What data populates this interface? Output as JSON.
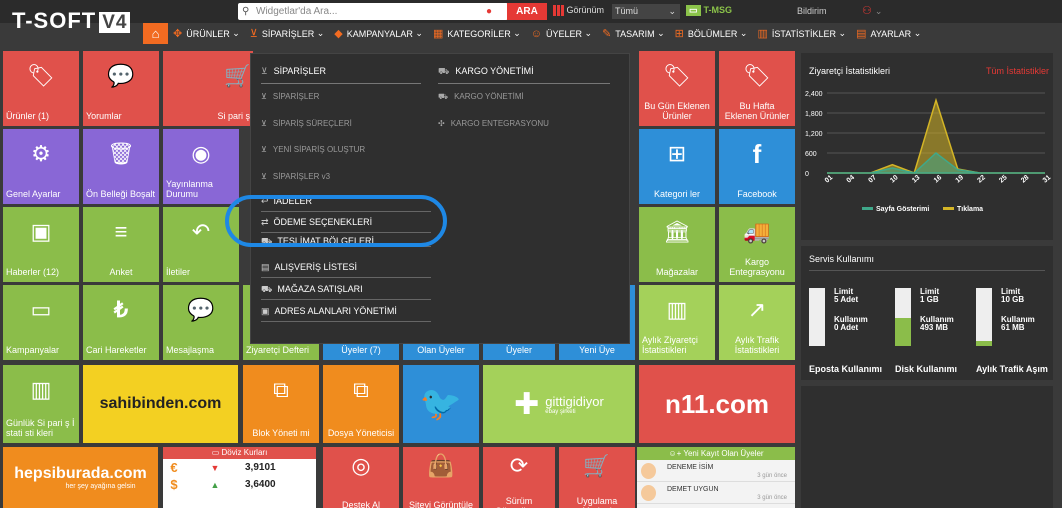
{
  "topbar": {
    "logo_text": "T-SOFT",
    "logo_version": "V4",
    "search_placeholder": "Widgetlar'da Ara...",
    "search_button": "ARA",
    "view_label": "Görünüm",
    "view_selected": "Tümü",
    "tmsg_label": "T-MSG",
    "notifications_label": "Bildirim"
  },
  "nav": {
    "items": [
      {
        "icon": "puzzle-icon",
        "glyph": "✥",
        "label": "ÜRÜNLER"
      },
      {
        "icon": "cart-icon",
        "glyph": "🛒",
        "label": "SİPARİŞLER"
      },
      {
        "icon": "tag-icon",
        "glyph": "◆",
        "label": "KAMPANYALAR"
      },
      {
        "icon": "categories-icon",
        "glyph": "▦",
        "label": "KATEGORİLER"
      },
      {
        "icon": "user-icon",
        "glyph": "☺",
        "label": "ÜYELER"
      },
      {
        "icon": "brush-icon",
        "glyph": "✎",
        "label": "TASARIM"
      },
      {
        "icon": "sitemap-icon",
        "glyph": "⊞",
        "label": "BÖLÜMLER"
      },
      {
        "icon": "chart-icon",
        "glyph": "▥",
        "label": "İSTATİSTİKLER"
      },
      {
        "icon": "settings-icon",
        "glyph": "▤",
        "label": "AYARLAR"
      }
    ]
  },
  "tiles": {
    "urunler": "Ürünler (1)",
    "yorumlar": "Yorumlar",
    "siparis": "Si pari ş",
    "bugun": "Bu Gün Eklenen Ürünler",
    "buhafta": "Bu Hafta Eklenen Ürünler",
    "genel_ayarlar": "Genel Ayarlar",
    "onbellek": "Ön Belleği Boşalt",
    "yayinlanma": "Yayınlanma Durumu",
    "kategoriler": "Kategori ler",
    "facebook": "Facebook",
    "haberler": "Haberler (12)",
    "anket": "Anket",
    "iletiler": "İletiler",
    "magazalar": "Mağazalar",
    "kargo": "Kargo Entegrasyonu",
    "kampanyalar": "Kampanyalar",
    "cari": "Cari Hareketler",
    "mesajlasma": "Mesajlaşma",
    "ziyaretci_defteri": "Ziyaretçi Defteri",
    "uyeler": "Üyeler (7)",
    "olan_uyeler": "Olan Üyeler",
    "uyeler2": "Üyeler",
    "yeni_uye": "Yeni Üye",
    "aylik_ziyaretci": "Aylık Ziyaretçi İstatistikleri",
    "aylik_trafik": "Aylık Trafik İstatistikleri",
    "gunluk": "Günlük Si pari ş İ stati sti kleri",
    "sahibinden": "sahibinden.com",
    "blok": "Blok Yöneti mi",
    "dosya": "Dosya Yöneticisi",
    "gittigidiyor": "gittigidiyor",
    "gittigidiyor_sub": "ebay şirketi",
    "n11": "n11.com",
    "hepsiburada": "hepsiburada.com",
    "hepsiburada_sub": "her şey ayağına gelsin",
    "destek": "Destek Al",
    "site_goruntule": "Siteyi Görüntüle",
    "surum": "Sürüm Güncelleme",
    "uygulama": "Uygulama Marketi"
  },
  "dropdown": {
    "col1_head": "SİPARİŞLER",
    "col1_items": [
      "SİPARİŞLER",
      "SİPARİŞ SÜREÇLERİ",
      "YENİ SİPARİŞ OLUŞTUR",
      "SİPARİŞLER v3"
    ],
    "col2_head": "KARGO YÖNETİMİ",
    "col2_items": [
      "KARGO YÖNETİMİ",
      "KARGO ENTEGRASYONU"
    ],
    "rows": [
      "İADELER",
      "ÖDEME SEÇENEKLERİ",
      "TESLİMAT BÖLGELERİ",
      "ALIŞVERİŞ LİSTESİ",
      "MAĞAZA SATIŞLARI",
      "ADRES ALANLARI YÖNETİMİ"
    ]
  },
  "stats": {
    "title": "Ziyaretçi İstatistikleri",
    "link": "Tüm İstatistikler",
    "legend": [
      "Sayfa Gösterimi",
      "Tıklama"
    ]
  },
  "chart_data": {
    "type": "area",
    "x": [
      "01",
      "04",
      "07",
      "10",
      "13",
      "16",
      "19",
      "22",
      "25",
      "28",
      "31"
    ],
    "yticks": [
      "2,400",
      "1,800",
      "1,200",
      "600",
      "0"
    ],
    "ylim": [
      0,
      2400
    ],
    "series": [
      {
        "name": "Sayfa Gösterimi",
        "color": "#3fa88a",
        "values": [
          0,
          0,
          0,
          150,
          0,
          600,
          100,
          0,
          0,
          0,
          0
        ]
      },
      {
        "name": "Tıklama",
        "color": "#d4b526",
        "values": [
          0,
          0,
          0,
          250,
          0,
          2180,
          120,
          0,
          0,
          0,
          0
        ]
      }
    ]
  },
  "service": {
    "title": "Servis Kullanımı",
    "items": [
      {
        "limit_label": "Limit",
        "limit": "5 Adet",
        "used_label": "Kullanım",
        "used": "0 Adet",
        "caption": "Eposta Kullanımı",
        "fill": 0
      },
      {
        "limit_label": "Limit",
        "limit": "1 GB",
        "used_label": "Kullanım",
        "used": "493 MB",
        "caption": "Disk Kullanımı",
        "fill": 0.48
      },
      {
        "limit_label": "Limit",
        "limit": "10 GB",
        "used_label": "Kullanım",
        "used": "61 MB",
        "caption": "Aylık Trafik Aşım",
        "fill": 0.08
      }
    ]
  },
  "doviz": {
    "title": "Döviz Kurları",
    "rows": [
      {
        "sym": "€",
        "dir": "down",
        "value": "3,9101"
      },
      {
        "sym": "$",
        "dir": "up",
        "value": "3,6400"
      }
    ]
  },
  "yeni_uyeler": {
    "title": "Yeni Kayıt Olan Üyeler",
    "rows": [
      {
        "name": "DENEME İSİM",
        "time": "3 gün önce"
      },
      {
        "name": "DEMET UYGUN",
        "time": "3 gün önce"
      }
    ]
  }
}
